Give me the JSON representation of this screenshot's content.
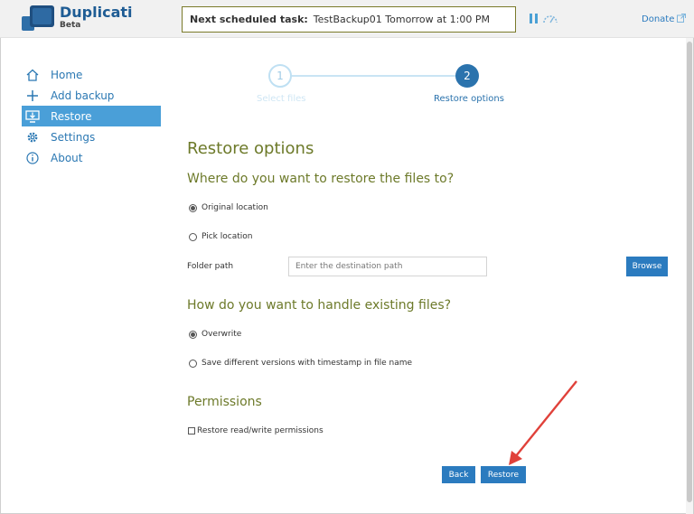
{
  "brand": {
    "name": "Duplicati",
    "sub": "Beta"
  },
  "header": {
    "schedule_label": "Next scheduled task:",
    "schedule_value": "TestBackup01 Tomorrow at 1:00 PM",
    "donate_label": "Donate"
  },
  "nav": {
    "items": [
      {
        "label": "Home",
        "icon": "home-icon"
      },
      {
        "label": "Add backup",
        "icon": "plus-icon"
      },
      {
        "label": "Restore",
        "icon": "restore-icon",
        "active": true
      },
      {
        "label": "Settings",
        "icon": "gear-icon"
      },
      {
        "label": "About",
        "icon": "info-icon"
      }
    ]
  },
  "steps": {
    "items": [
      {
        "number": "1",
        "label": "Select files"
      },
      {
        "number": "2",
        "label": "Restore options"
      }
    ]
  },
  "content": {
    "title": "Restore options",
    "where_heading": "Where do you want to restore the files to?",
    "opt_original": "Original location",
    "opt_pick": "Pick location",
    "folder_label": "Folder path",
    "folder_placeholder": "Enter the destination path",
    "browse_label": "Browse",
    "existing_heading": "How do you want to handle existing files?",
    "opt_overwrite": "Overwrite",
    "opt_versions": "Save different versions with timestamp in file name",
    "permissions_heading": "Permissions",
    "permissions_check": "Restore read/write permissions",
    "back_label": "Back",
    "restore_label": "Restore"
  },
  "colors": {
    "accent": "#2b7bbf",
    "heading": "#6d7a2a",
    "nav_active": "#4a9fd8",
    "annotation_arrow": "#e0413a"
  }
}
